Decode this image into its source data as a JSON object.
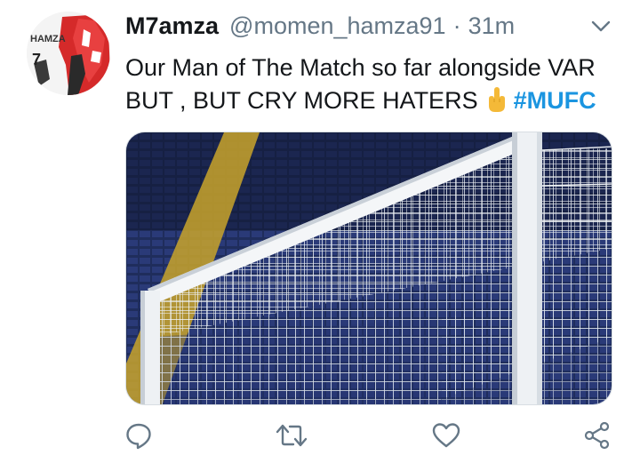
{
  "tweet": {
    "display_name": "M7amza",
    "handle": "@momen_hamza91",
    "separator": "·",
    "timestamp": "31m",
    "text_line1": "Our Man of The Match so far alongside VAR",
    "text_line2": "BUT , BUT CRY MORE HATERS",
    "emoji": "middle-finger-emoji",
    "hashtag": "#MUFC",
    "avatar_text": "HAMZA"
  },
  "icons": {
    "menu": "chevron-down-icon",
    "reply": "reply-icon",
    "retweet": "retweet-icon",
    "like": "heart-icon",
    "share": "share-icon"
  },
  "colors": {
    "accent": "#1b95e0",
    "secondary_text": "#657786",
    "primary_text": "#14171a"
  }
}
